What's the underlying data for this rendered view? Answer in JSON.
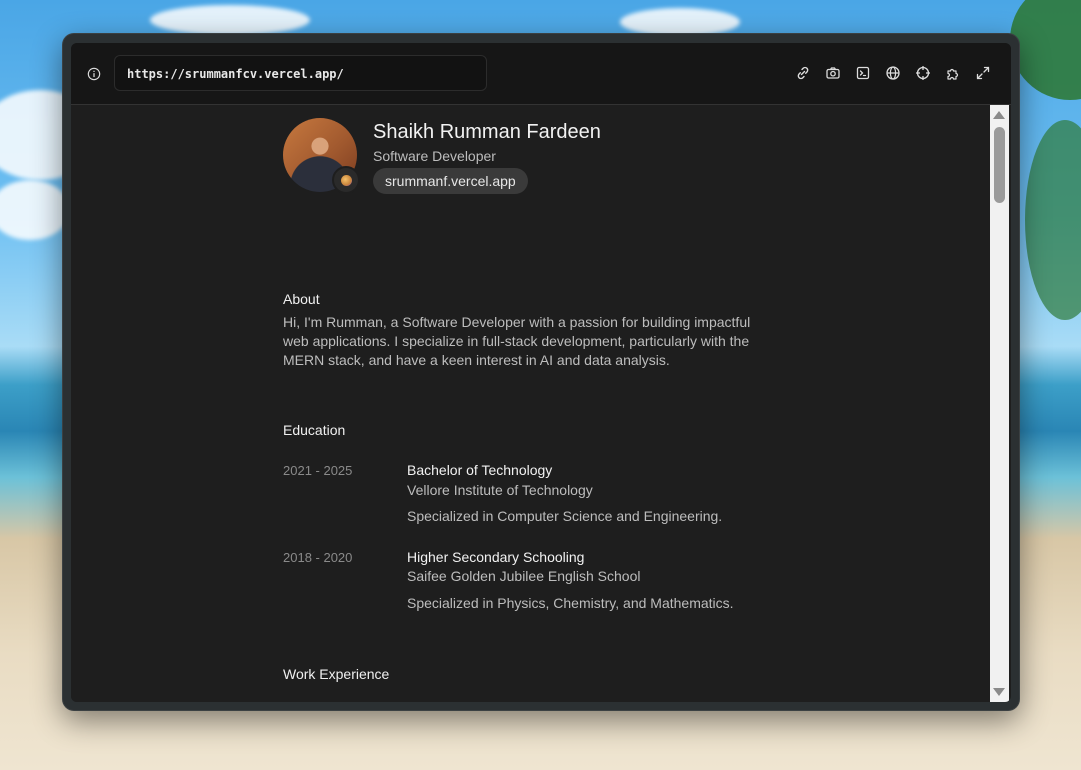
{
  "browser": {
    "url": "https://srummanfcv.vercel.app/",
    "icons": [
      "info-icon",
      "link-icon",
      "camera-icon",
      "terminal-icon",
      "globe-icon",
      "crosshair-icon",
      "puzzle-icon",
      "expand-icon"
    ]
  },
  "profile": {
    "name": "Shaikh Rumman Fardeen",
    "role": "Software Developer",
    "website": "srummanf.vercel.app"
  },
  "about": {
    "title": "About",
    "text": "Hi, I'm Rumman, a Software Developer with a passion for building impactful web applications. I specialize in full-stack development, particularly with the MERN stack, and have a keen interest in AI and data analysis."
  },
  "education": {
    "title": "Education",
    "items": [
      {
        "years": "2021 - 2025",
        "degree": "Bachelor of Technology",
        "school": "Vellore Institute of Technology",
        "desc": "Specialized in Computer Science and Engineering."
      },
      {
        "years": "2018 - 2020",
        "degree": "Higher Secondary Schooling",
        "school": "Saifee Golden Jubilee English School",
        "desc": "Specialized in Physics, Chemistry, and Mathematics."
      }
    ]
  },
  "work": {
    "title": "Work Experience"
  }
}
